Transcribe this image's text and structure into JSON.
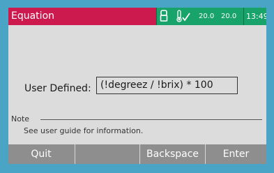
{
  "header": {
    "title": "Equation",
    "temperature_1": "20.0",
    "temperature_2": "20.0",
    "time": "13:49",
    "lock_icon": "lock-icon",
    "temperature_icon": "thermometer-check-icon",
    "colors": {
      "title_bar": "#cc1a4e",
      "status": "#18a36a"
    }
  },
  "equation": {
    "label": "User Defined:",
    "value": "(!degreez / !brix) * 100"
  },
  "note": {
    "label": "Note",
    "text": "See user guide for information."
  },
  "softkeys": [
    "Quit",
    "",
    "Backspace",
    "Enter"
  ],
  "colors": {
    "bezel": "#4aa4c6",
    "screen_background": "#dcdcdc",
    "softkey_bar": "#8e8e8e"
  }
}
